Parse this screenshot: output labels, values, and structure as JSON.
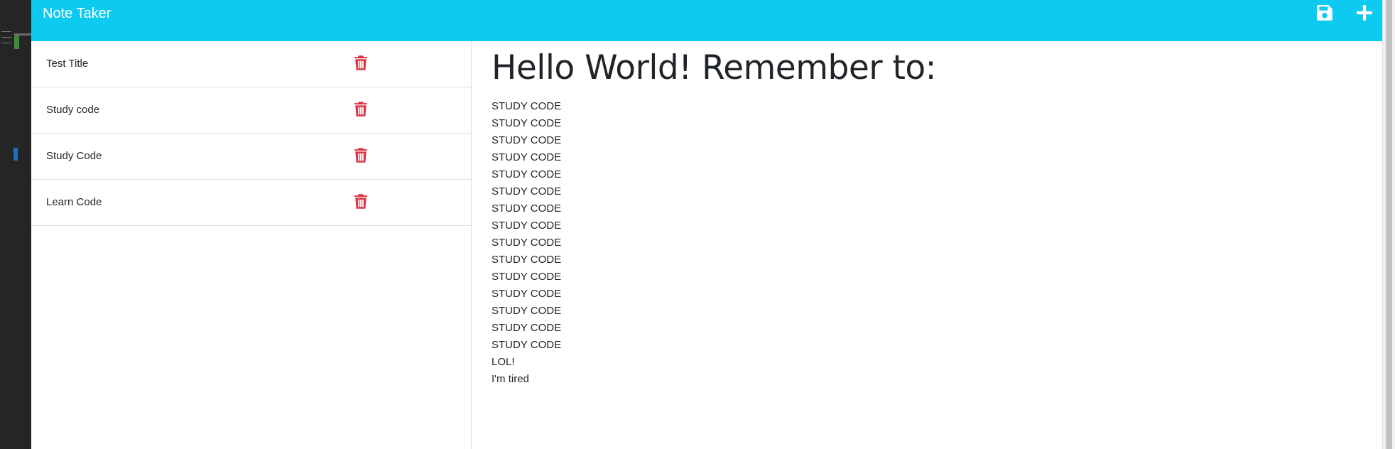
{
  "app": {
    "title": "Note Taker",
    "accent_color": "#0dcaf0",
    "delete_color": "#dc3545",
    "icons": {
      "save": "floppy-disk-icon",
      "new": "plus-icon",
      "delete": "trash-icon"
    }
  },
  "notes": [
    {
      "title": "Test Title"
    },
    {
      "title": "Study code"
    },
    {
      "title": "Study Code"
    },
    {
      "title": "Learn Code"
    }
  ],
  "active_note": {
    "title": "Hello World! Remember to:",
    "text": "STUDY CODE\nSTUDY CODE\nSTUDY CODE\nSTUDY CODE\nSTUDY CODE\nSTUDY CODE\nSTUDY CODE\nSTUDY CODE\nSTUDY CODE\nSTUDY CODE\nSTUDY CODE\nSTUDY CODE\nSTUDY CODE\nSTUDY CODE\nSTUDY CODE\nLOL!\nI'm tired"
  }
}
